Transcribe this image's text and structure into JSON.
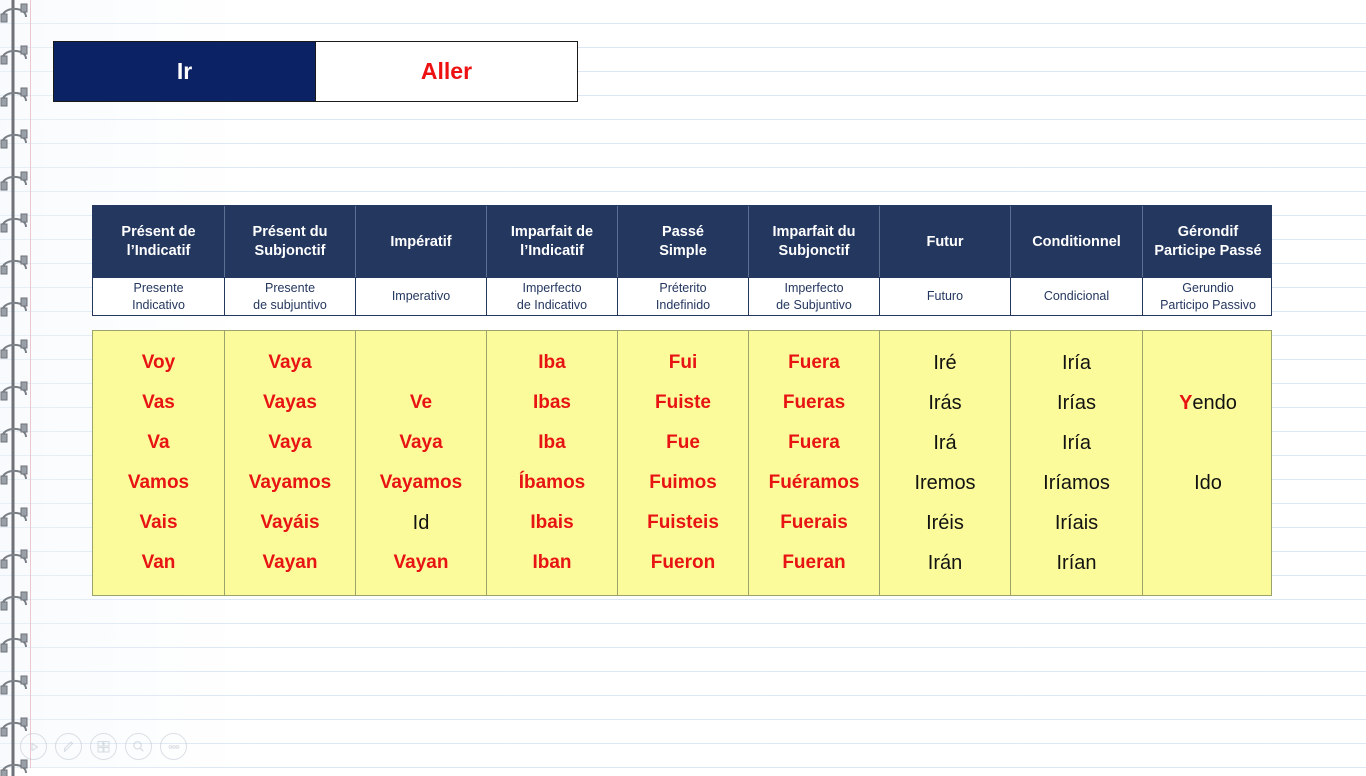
{
  "title_tabs": {
    "spanish": "Ir",
    "french": "Aller"
  },
  "colors": {
    "navy_header": "#24375F",
    "navy_title": "#0B2265",
    "red_text": "#E81414",
    "yellow_cell": "#FBFB9B",
    "black_text": "#121212"
  },
  "table": {
    "columns": [
      {
        "fr_line1": "Présent de",
        "fr_line2": "l’Indicatif",
        "es_line1": "Presente",
        "es_line2": "Indicativo"
      },
      {
        "fr_line1": "Présent du",
        "fr_line2": "Subjonctif",
        "es_line1": "Presente",
        "es_line2": "de subjuntivo"
      },
      {
        "fr_line1": "Impératif",
        "fr_line2": "",
        "es_line1": "Imperativo",
        "es_line2": ""
      },
      {
        "fr_line1": "Imparfait de",
        "fr_line2": "l’Indicatif",
        "es_line1": "Imperfecto",
        "es_line2": "de Indicativo"
      },
      {
        "fr_line1": "Passé",
        "fr_line2": "Simple",
        "es_line1": "Préterito",
        "es_line2": "Indefinido"
      },
      {
        "fr_line1": "Imparfait du",
        "fr_line2": "Subjonctif",
        "es_line1": "Imperfecto",
        "es_line2": "de Subjuntivo"
      },
      {
        "fr_line1": "Futur",
        "fr_line2": "",
        "es_line1": "Futuro",
        "es_line2": ""
      },
      {
        "fr_line1": "Conditionnel",
        "fr_line2": "",
        "es_line1": "Condicional",
        "es_line2": ""
      },
      {
        "fr_line1": "Gérondif",
        "fr_line2": "Participe Passé",
        "es_line1": "Gerundio",
        "es_line2": "Participo Passivo"
      }
    ],
    "body": [
      {
        "column": "Présent de l’Indicatif",
        "style": "red",
        "cells": [
          "Voy",
          "Vas",
          "Va",
          "Vamos",
          "Vais",
          "Van"
        ]
      },
      {
        "column": "Présent du Subjonctif",
        "style": "red",
        "cells": [
          "Vaya",
          "Vayas",
          "Vaya",
          "Vayamos",
          "Vayáis",
          "Vayan"
        ]
      },
      {
        "column": "Impératif",
        "style": "red",
        "cells": [
          "",
          "Ve",
          "Vaya",
          "Vayamos",
          "Id",
          "Vayan"
        ],
        "cell_styles": [
          "empty",
          "red",
          "red",
          "red",
          "black",
          "red"
        ]
      },
      {
        "column": "Imparfait de l’Indicatif",
        "style": "red",
        "cells": [
          "Iba",
          "Ibas",
          "Iba",
          "Íbamos",
          "Ibais",
          "Iban"
        ]
      },
      {
        "column": "Passé Simple",
        "style": "red",
        "cells": [
          "Fui",
          "Fuiste",
          "Fue",
          "Fuimos",
          "Fuisteis",
          "Fueron"
        ]
      },
      {
        "column": "Imparfait du Subjonctif",
        "style": "red",
        "cells": [
          "Fuera",
          "Fueras",
          "Fuera",
          "Fuéramos",
          "Fuerais",
          "Fueran"
        ]
      },
      {
        "column": "Futur",
        "style": "black",
        "cells": [
          "Iré",
          "Irás",
          "Irá",
          "Iremos",
          "Iréis",
          "Irán"
        ]
      },
      {
        "column": "Conditionnel",
        "style": "black",
        "cells": [
          "Iría",
          "Irías",
          "Iría",
          "Iríamos",
          "Iríais",
          "Irían"
        ]
      },
      {
        "column": "Gérondif / Participe Passé",
        "style": "black",
        "cells": [
          "",
          "Yendo",
          "",
          "Ido",
          "",
          ""
        ],
        "cell_styles": [
          "empty",
          "black-hl1",
          "empty",
          "black",
          "empty",
          "empty"
        ]
      }
    ]
  },
  "toolbar": {
    "buttons": [
      {
        "name": "play-icon",
        "label": "Play"
      },
      {
        "name": "pen-icon",
        "label": "Pen"
      },
      {
        "name": "slides-icon",
        "label": "All Slides"
      },
      {
        "name": "zoom-icon",
        "label": "Zoom"
      },
      {
        "name": "more-options-icon",
        "label": "More options"
      }
    ]
  }
}
